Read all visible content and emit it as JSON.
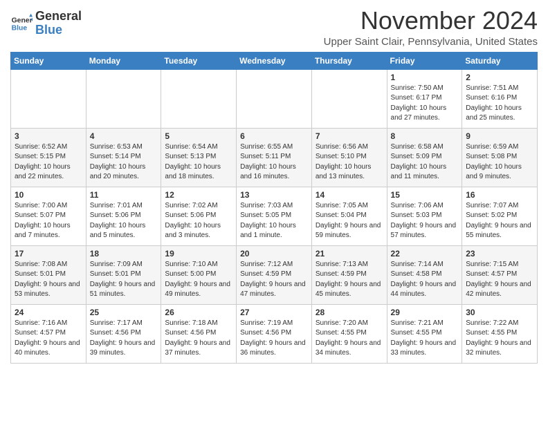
{
  "header": {
    "logo_general": "General",
    "logo_blue": "Blue",
    "month_title": "November 2024",
    "location": "Upper Saint Clair, Pennsylvania, United States"
  },
  "weekdays": [
    "Sunday",
    "Monday",
    "Tuesday",
    "Wednesday",
    "Thursday",
    "Friday",
    "Saturday"
  ],
  "weeks": [
    [
      {
        "day": "",
        "info": ""
      },
      {
        "day": "",
        "info": ""
      },
      {
        "day": "",
        "info": ""
      },
      {
        "day": "",
        "info": ""
      },
      {
        "day": "",
        "info": ""
      },
      {
        "day": "1",
        "info": "Sunrise: 7:50 AM\nSunset: 6:17 PM\nDaylight: 10 hours and 27 minutes."
      },
      {
        "day": "2",
        "info": "Sunrise: 7:51 AM\nSunset: 6:16 PM\nDaylight: 10 hours and 25 minutes."
      }
    ],
    [
      {
        "day": "3",
        "info": "Sunrise: 6:52 AM\nSunset: 5:15 PM\nDaylight: 10 hours and 22 minutes."
      },
      {
        "day": "4",
        "info": "Sunrise: 6:53 AM\nSunset: 5:14 PM\nDaylight: 10 hours and 20 minutes."
      },
      {
        "day": "5",
        "info": "Sunrise: 6:54 AM\nSunset: 5:13 PM\nDaylight: 10 hours and 18 minutes."
      },
      {
        "day": "6",
        "info": "Sunrise: 6:55 AM\nSunset: 5:11 PM\nDaylight: 10 hours and 16 minutes."
      },
      {
        "day": "7",
        "info": "Sunrise: 6:56 AM\nSunset: 5:10 PM\nDaylight: 10 hours and 13 minutes."
      },
      {
        "day": "8",
        "info": "Sunrise: 6:58 AM\nSunset: 5:09 PM\nDaylight: 10 hours and 11 minutes."
      },
      {
        "day": "9",
        "info": "Sunrise: 6:59 AM\nSunset: 5:08 PM\nDaylight: 10 hours and 9 minutes."
      }
    ],
    [
      {
        "day": "10",
        "info": "Sunrise: 7:00 AM\nSunset: 5:07 PM\nDaylight: 10 hours and 7 minutes."
      },
      {
        "day": "11",
        "info": "Sunrise: 7:01 AM\nSunset: 5:06 PM\nDaylight: 10 hours and 5 minutes."
      },
      {
        "day": "12",
        "info": "Sunrise: 7:02 AM\nSunset: 5:06 PM\nDaylight: 10 hours and 3 minutes."
      },
      {
        "day": "13",
        "info": "Sunrise: 7:03 AM\nSunset: 5:05 PM\nDaylight: 10 hours and 1 minute."
      },
      {
        "day": "14",
        "info": "Sunrise: 7:05 AM\nSunset: 5:04 PM\nDaylight: 9 hours and 59 minutes."
      },
      {
        "day": "15",
        "info": "Sunrise: 7:06 AM\nSunset: 5:03 PM\nDaylight: 9 hours and 57 minutes."
      },
      {
        "day": "16",
        "info": "Sunrise: 7:07 AM\nSunset: 5:02 PM\nDaylight: 9 hours and 55 minutes."
      }
    ],
    [
      {
        "day": "17",
        "info": "Sunrise: 7:08 AM\nSunset: 5:01 PM\nDaylight: 9 hours and 53 minutes."
      },
      {
        "day": "18",
        "info": "Sunrise: 7:09 AM\nSunset: 5:01 PM\nDaylight: 9 hours and 51 minutes."
      },
      {
        "day": "19",
        "info": "Sunrise: 7:10 AM\nSunset: 5:00 PM\nDaylight: 9 hours and 49 minutes."
      },
      {
        "day": "20",
        "info": "Sunrise: 7:12 AM\nSunset: 4:59 PM\nDaylight: 9 hours and 47 minutes."
      },
      {
        "day": "21",
        "info": "Sunrise: 7:13 AM\nSunset: 4:59 PM\nDaylight: 9 hours and 45 minutes."
      },
      {
        "day": "22",
        "info": "Sunrise: 7:14 AM\nSunset: 4:58 PM\nDaylight: 9 hours and 44 minutes."
      },
      {
        "day": "23",
        "info": "Sunrise: 7:15 AM\nSunset: 4:57 PM\nDaylight: 9 hours and 42 minutes."
      }
    ],
    [
      {
        "day": "24",
        "info": "Sunrise: 7:16 AM\nSunset: 4:57 PM\nDaylight: 9 hours and 40 minutes."
      },
      {
        "day": "25",
        "info": "Sunrise: 7:17 AM\nSunset: 4:56 PM\nDaylight: 9 hours and 39 minutes."
      },
      {
        "day": "26",
        "info": "Sunrise: 7:18 AM\nSunset: 4:56 PM\nDaylight: 9 hours and 37 minutes."
      },
      {
        "day": "27",
        "info": "Sunrise: 7:19 AM\nSunset: 4:56 PM\nDaylight: 9 hours and 36 minutes."
      },
      {
        "day": "28",
        "info": "Sunrise: 7:20 AM\nSunset: 4:55 PM\nDaylight: 9 hours and 34 minutes."
      },
      {
        "day": "29",
        "info": "Sunrise: 7:21 AM\nSunset: 4:55 PM\nDaylight: 9 hours and 33 minutes."
      },
      {
        "day": "30",
        "info": "Sunrise: 7:22 AM\nSunset: 4:55 PM\nDaylight: 9 hours and 32 minutes."
      }
    ]
  ]
}
